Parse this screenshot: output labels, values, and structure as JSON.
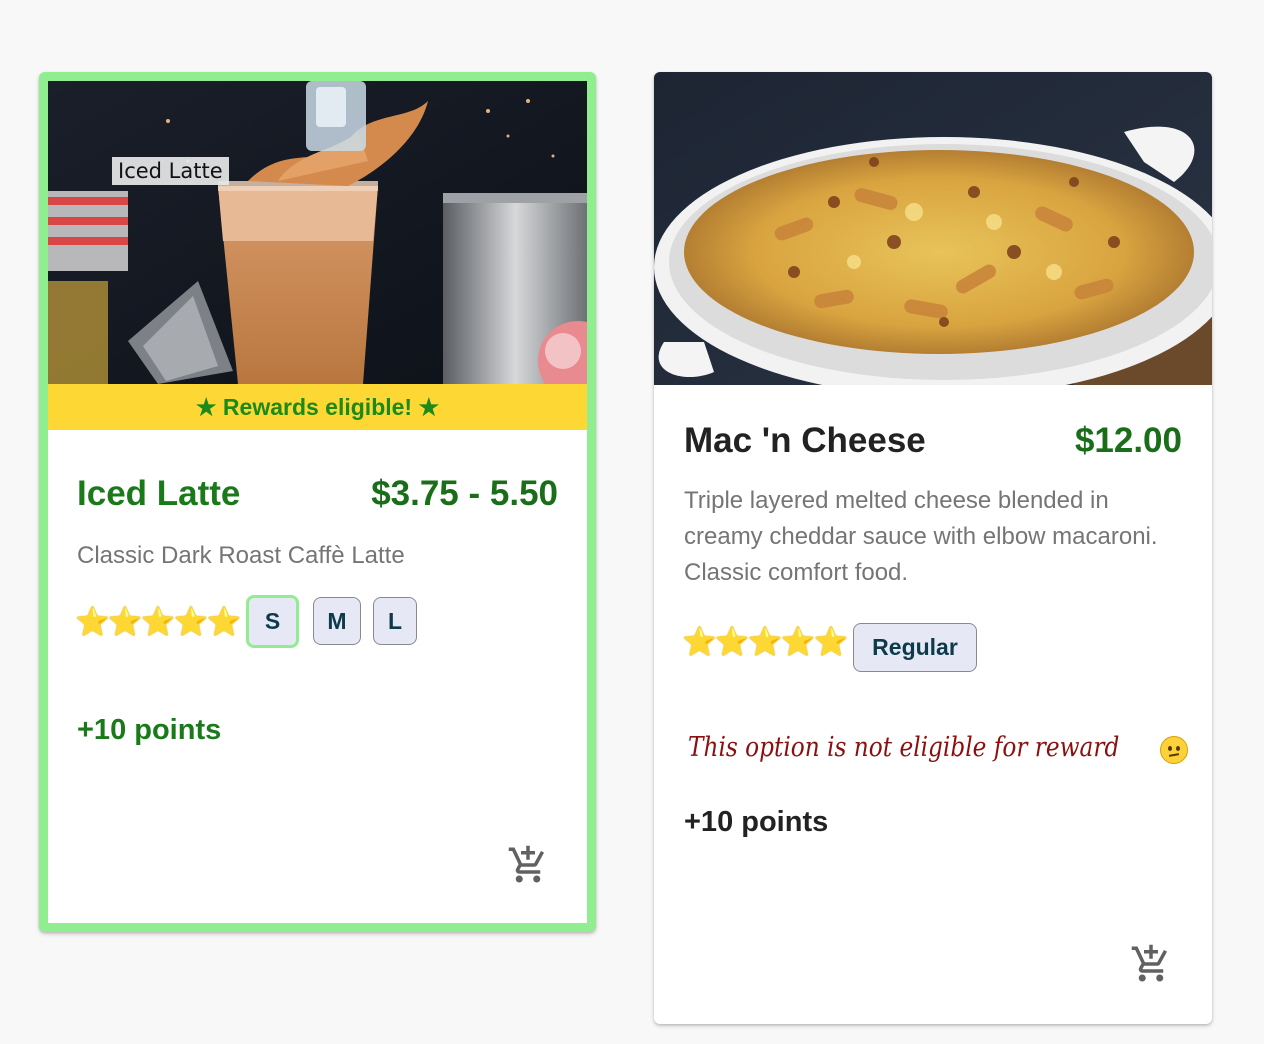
{
  "colors": {
    "price_green": "#1a6e1a",
    "highlight_border": "#90ee90",
    "banner_yellow": "#fdd835",
    "warning_red": "#8b0f0f"
  },
  "cards": [
    {
      "image_alt": "Iced Latte",
      "image_label": "Iced Latte",
      "banner": "★ Rewards eligible! ★",
      "title": "Iced Latte",
      "title_color": "#1a7a1a",
      "price": "$3.75 - 5.50",
      "description": "Classic Dark Roast Caffè Latte",
      "stars": "⭐⭐⭐⭐⭐",
      "rating": 5,
      "sizes": [
        "S",
        "M",
        "L"
      ],
      "selected_size": "S",
      "points": "+10 points",
      "points_color": "#1a7a1a",
      "cart_icon": "add-shopping-cart-icon",
      "highlighted": true
    },
    {
      "image_alt": "Mac 'n Cheese",
      "title": "Mac 'n Cheese",
      "title_color": "#222222",
      "price": "$12.00",
      "description": "Triple layered melted cheese blended in creamy cheddar sauce with elbow macaroni. Classic comfort food.",
      "stars": "⭐⭐⭐⭐⭐",
      "rating": 5,
      "sizes": [
        "Regular"
      ],
      "not_eligible": "This option is not eligible for reward",
      "not_eligible_icon": "confused-face-icon",
      "points": "+10 points",
      "points_color": "#222222",
      "cart_icon": "add-shopping-cart-icon",
      "highlighted": false
    }
  ]
}
